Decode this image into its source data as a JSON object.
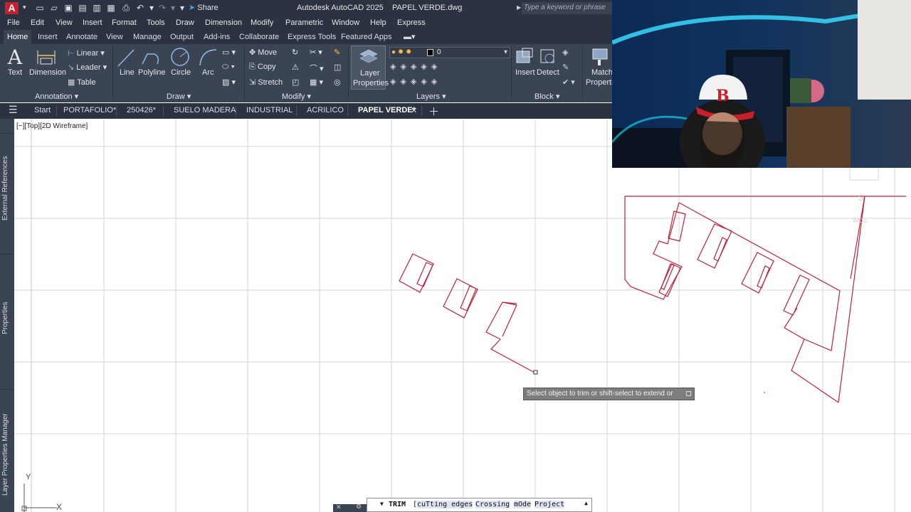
{
  "title_bar": {
    "logo": "A",
    "share_label": "Share",
    "app_name": "Autodesk AutoCAD 2025",
    "file_name": "PAPEL VERDE.dwg",
    "search_placeholder": "Type a keyword or phrase"
  },
  "menu": [
    "File",
    "Edit",
    "View",
    "Insert",
    "Format",
    "Tools",
    "Draw",
    "Dimension",
    "Modify",
    "Parametric",
    "Window",
    "Help",
    "Express"
  ],
  "ribbon_tabs": [
    "Home",
    "Insert",
    "Annotate",
    "View",
    "Manage",
    "Output",
    "Add-ins",
    "Collaborate",
    "Express Tools",
    "Featured Apps"
  ],
  "active_ribbon_tab": "Home",
  "ribbon": {
    "annotation": {
      "title": "Annotation",
      "text": "Text",
      "dimension": "Dimension",
      "linear": "Linear",
      "leader": "Leader",
      "table": "Table"
    },
    "draw": {
      "title": "Draw",
      "line": "Line",
      "polyline": "Polyline",
      "circle": "Circle",
      "arc": "Arc"
    },
    "modify": {
      "title": "Modify",
      "move": "Move",
      "copy": "Copy",
      "stretch": "Stretch"
    },
    "layers": {
      "title": "Layers",
      "layer_properties_1": "Layer",
      "layer_properties_2": "Properties",
      "current_layer": "0"
    },
    "block": {
      "title": "Block",
      "insert": "Insert",
      "detect": "Detect"
    },
    "match_1": "Match",
    "match_2": "Properties"
  },
  "doc_tabs": [
    "Start",
    "PORTAFOLIO*",
    "250426*",
    "SUELO MADERA",
    "INDUSTRIAL",
    "ACRILICO",
    "PAPEL VERDE*"
  ],
  "active_doc_tab": "PAPEL VERDE*",
  "palettes": [
    "External References",
    "Properties",
    "Layer Properties Manager"
  ],
  "viewport_label": "[−][Top][2D Wireframe]",
  "ucs": {
    "y": "Y",
    "x": "X"
  },
  "viewcube": {
    "wcs": "WCS",
    "s": "S"
  },
  "tooltip": "Select object to trim or shift-select to extend or",
  "command_line": {
    "command": "TRIM",
    "open_bracket": "[",
    "options": [
      "cuTting edges",
      "Crossing",
      "mOde",
      "Project"
    ]
  },
  "colors": {
    "chrome_dark": "#2b3240",
    "ribbon_bg": "#3b4453",
    "drawing_line": "#c0223a",
    "grid": "#d0d0d0",
    "logo_red": "#c8202f",
    "share_blue": "#4aa3e8"
  },
  "icons": [
    "autocad-logo-icon",
    "new-icon",
    "open-icon",
    "save-icon",
    "saveas-icon",
    "export-icon",
    "plot-icon",
    "undo-icon",
    "redo-icon",
    "share-icon",
    "search-arrow-icon",
    "hamburger-menu-icon",
    "add-tab-icon",
    "close-tab-icon"
  ]
}
